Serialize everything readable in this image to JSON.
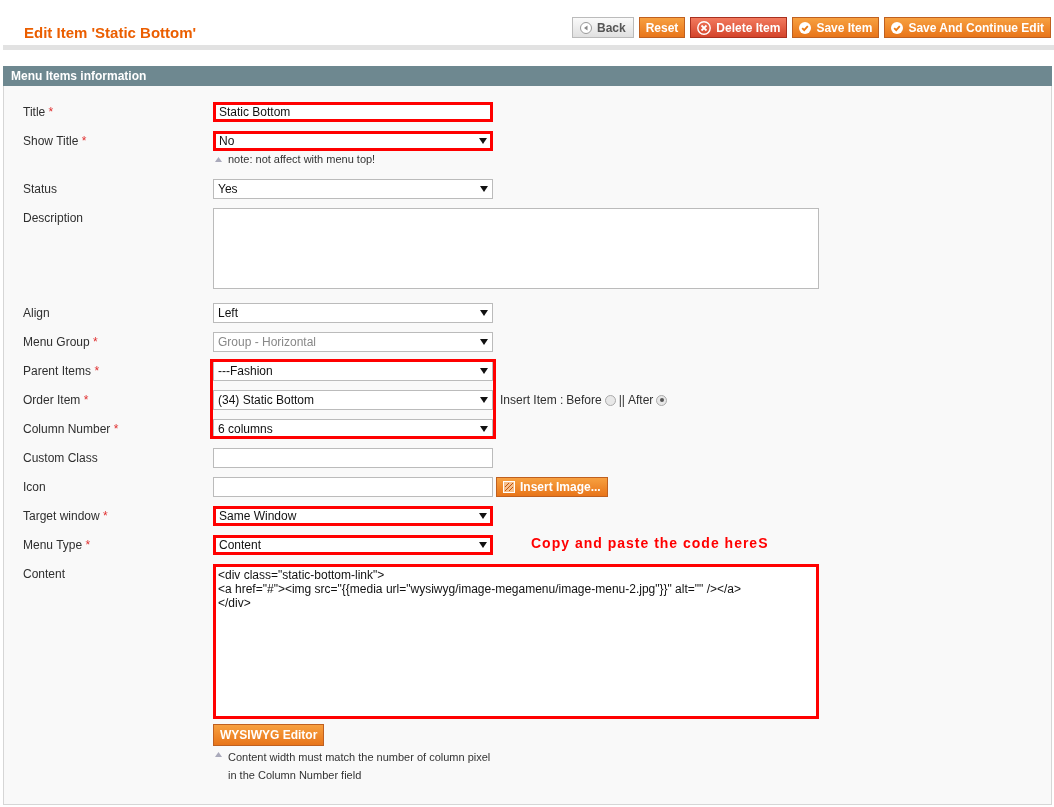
{
  "page": {
    "title": "Edit Item 'Static Bottom'"
  },
  "actions": [
    {
      "label": "Back",
      "kind": "back"
    },
    {
      "label": "Reset",
      "kind": "plain"
    },
    {
      "label": "Delete Item",
      "kind": "delete"
    },
    {
      "label": "Save Item",
      "kind": "save"
    },
    {
      "label": "Save And Continue Edit",
      "kind": "save"
    }
  ],
  "section": {
    "title": "Menu Items information"
  },
  "rows": [
    {
      "kind": "text",
      "label": "Title",
      "required_mark": "*",
      "value": "Static Bottom",
      "highlighted": true
    },
    {
      "kind": "select",
      "label": "Show Title",
      "required_mark": "*",
      "value": "No",
      "highlighted": true,
      "note": "note: not affect with menu top!"
    },
    {
      "kind": "select",
      "label": "Status",
      "value": "Yes",
      "highlighted": false
    },
    {
      "kind": "textarea",
      "label": "Description",
      "highlighted": false
    },
    {
      "kind": "select",
      "label": "Align",
      "value": "Left",
      "highlighted": false
    },
    {
      "kind": "select",
      "label": "Menu Group",
      "required_mark": "*",
      "value": "Group - Horizontal",
      "disabled": true,
      "highlighted": false
    },
    {
      "kind": "group",
      "highlighted": true,
      "children": [
        {
          "kind": "select",
          "label": "Parent Items",
          "required_mark": "*",
          "value": "---Fashion"
        },
        {
          "kind": "select",
          "label": "Order Item",
          "required_mark": "*",
          "value": "(34) Static Bottom",
          "insert": {
            "prefix": "Insert Item :",
            "separator": "||",
            "options": [
              {
                "label": "Before",
                "selected": false
              },
              {
                "label": "After",
                "selected": true
              }
            ]
          }
        },
        {
          "kind": "select",
          "label": "Column Number",
          "required_mark": "*",
          "value": "6 columns"
        }
      ]
    },
    {
      "kind": "text",
      "label": "Custom Class",
      "highlighted": false
    },
    {
      "kind": "text",
      "label": "Icon",
      "highlighted": false,
      "button": "Insert Image..."
    },
    {
      "kind": "select",
      "label": "Target window",
      "required_mark": "*",
      "value": "Same Window",
      "highlighted": true
    },
    {
      "kind": "select",
      "label": "Menu Type",
      "required_mark": "*",
      "value": "Content",
      "highlighted": true,
      "annotation": "Copy and paste the code hereS"
    },
    {
      "kind": "code",
      "label": "Content",
      "highlighted": true,
      "lines": [
        "<div class=\"static-bottom-link\">",
        "<a href=\"#\"><img src=\"{{media url=\"wysiwyg/image-megamenu/image-menu-2.jpg\"}}\" alt=\"\" /></a>",
        "</div>"
      ],
      "button": "WYSIWYG Editor",
      "note_lines": [
        "Content width must match the number of column pixel",
        "in the Column Number field"
      ]
    }
  ]
}
